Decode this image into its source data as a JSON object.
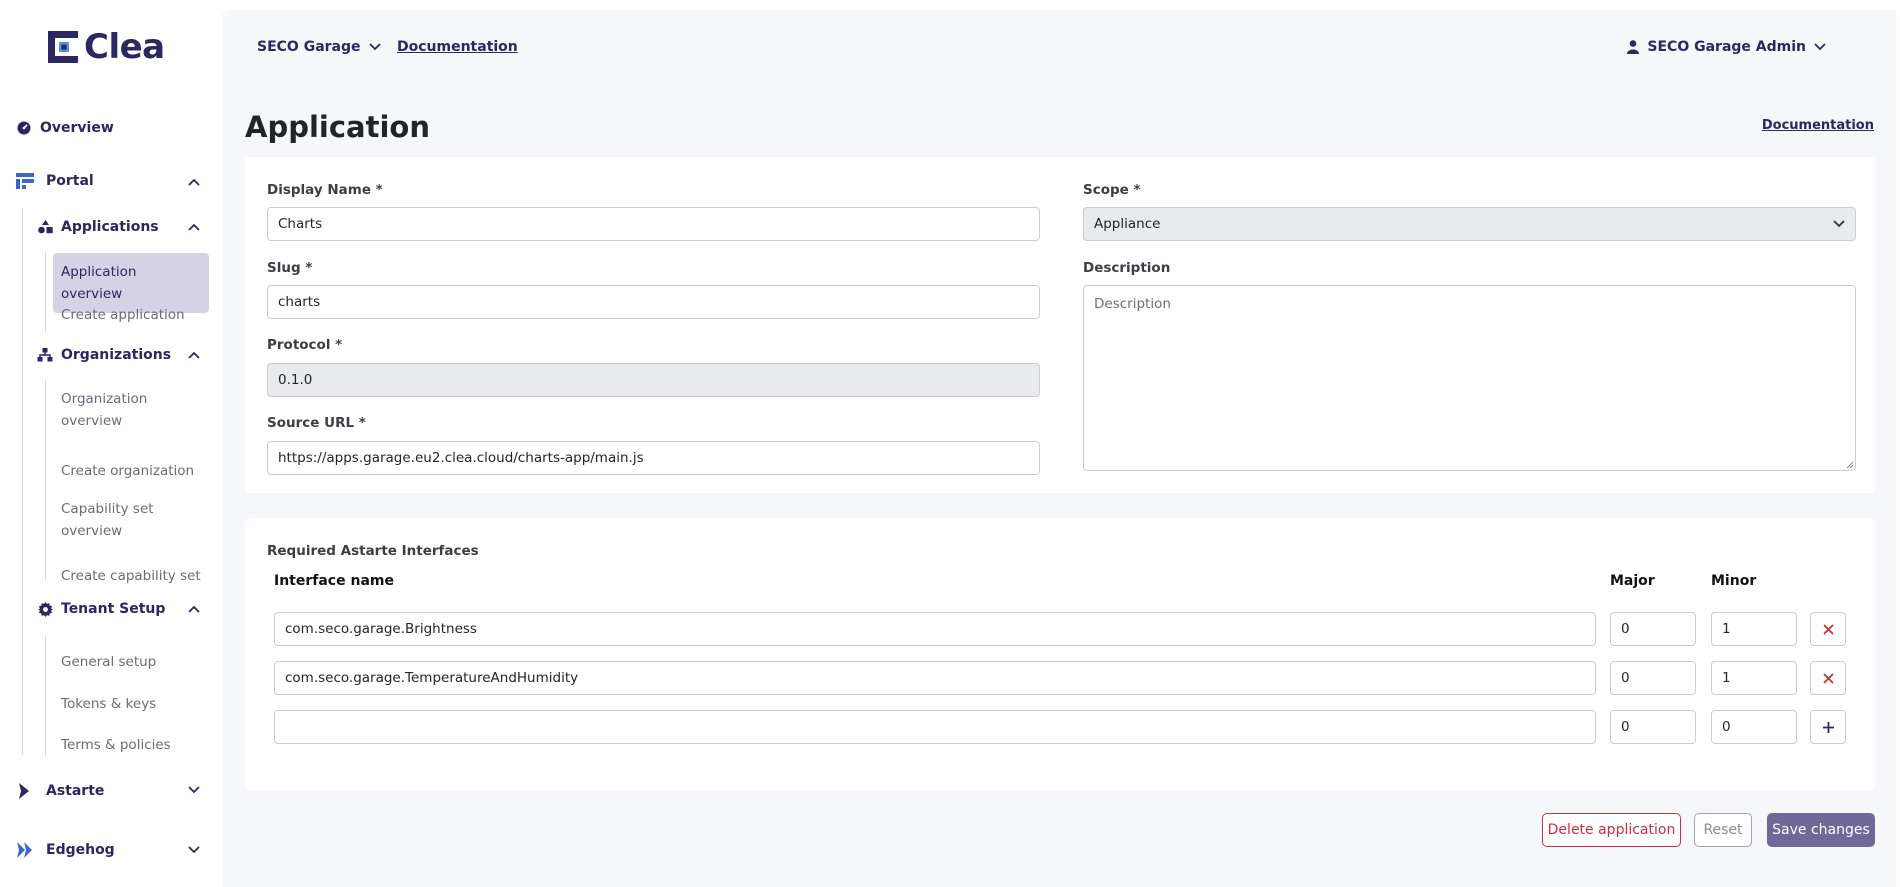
{
  "brand": {
    "name": "Clea"
  },
  "sidebar": {
    "overview": "Overview",
    "portal": "Portal",
    "applications": {
      "label": "Applications",
      "items": [
        "Application overview",
        "Create application"
      ]
    },
    "organizations": {
      "label": "Organizations",
      "items": [
        "Organization overview",
        "Create organization",
        "Capability set overview",
        "Create capability set"
      ]
    },
    "tenant_setup": {
      "label": "Tenant Setup",
      "items": [
        "General setup",
        "Tokens & keys",
        "Terms & policies"
      ]
    },
    "astarte": "Astarte",
    "edgehog": "Edgehog"
  },
  "topbar": {
    "tenant": "SECO Garage",
    "documentation": "Documentation",
    "user": "SECO Garage Admin"
  },
  "page": {
    "title": "Application",
    "documentation": "Documentation"
  },
  "form": {
    "display_name": {
      "label": "Display Name *",
      "value": "Charts"
    },
    "slug": {
      "label": "Slug *",
      "value": "charts"
    },
    "protocol": {
      "label": "Protocol *",
      "value": "0.1.0"
    },
    "source_url": {
      "label": "Source URL *",
      "value": "https://apps.garage.eu2.clea.cloud/charts-app/main.js"
    },
    "scope": {
      "label": "Scope *",
      "value": "Appliance"
    },
    "description": {
      "label": "Description",
      "placeholder": "Description"
    }
  },
  "interfaces": {
    "title": "Required Astarte Interfaces",
    "headers": {
      "name": "Interface name",
      "major": "Major",
      "minor": "Minor"
    },
    "rows": [
      {
        "name": "com.seco.garage.Brightness",
        "major": "0",
        "minor": "1"
      },
      {
        "name": "com.seco.garage.TemperatureAndHumidity",
        "major": "0",
        "minor": "1"
      }
    ],
    "new_row": {
      "name": "",
      "major": "0",
      "minor": "0"
    }
  },
  "actions": {
    "delete": "Delete application",
    "reset": "Reset",
    "save": "Save changes"
  },
  "colors": {
    "brand": "#2b2760",
    "danger": "#c7303c",
    "primary": "#6f6898"
  }
}
